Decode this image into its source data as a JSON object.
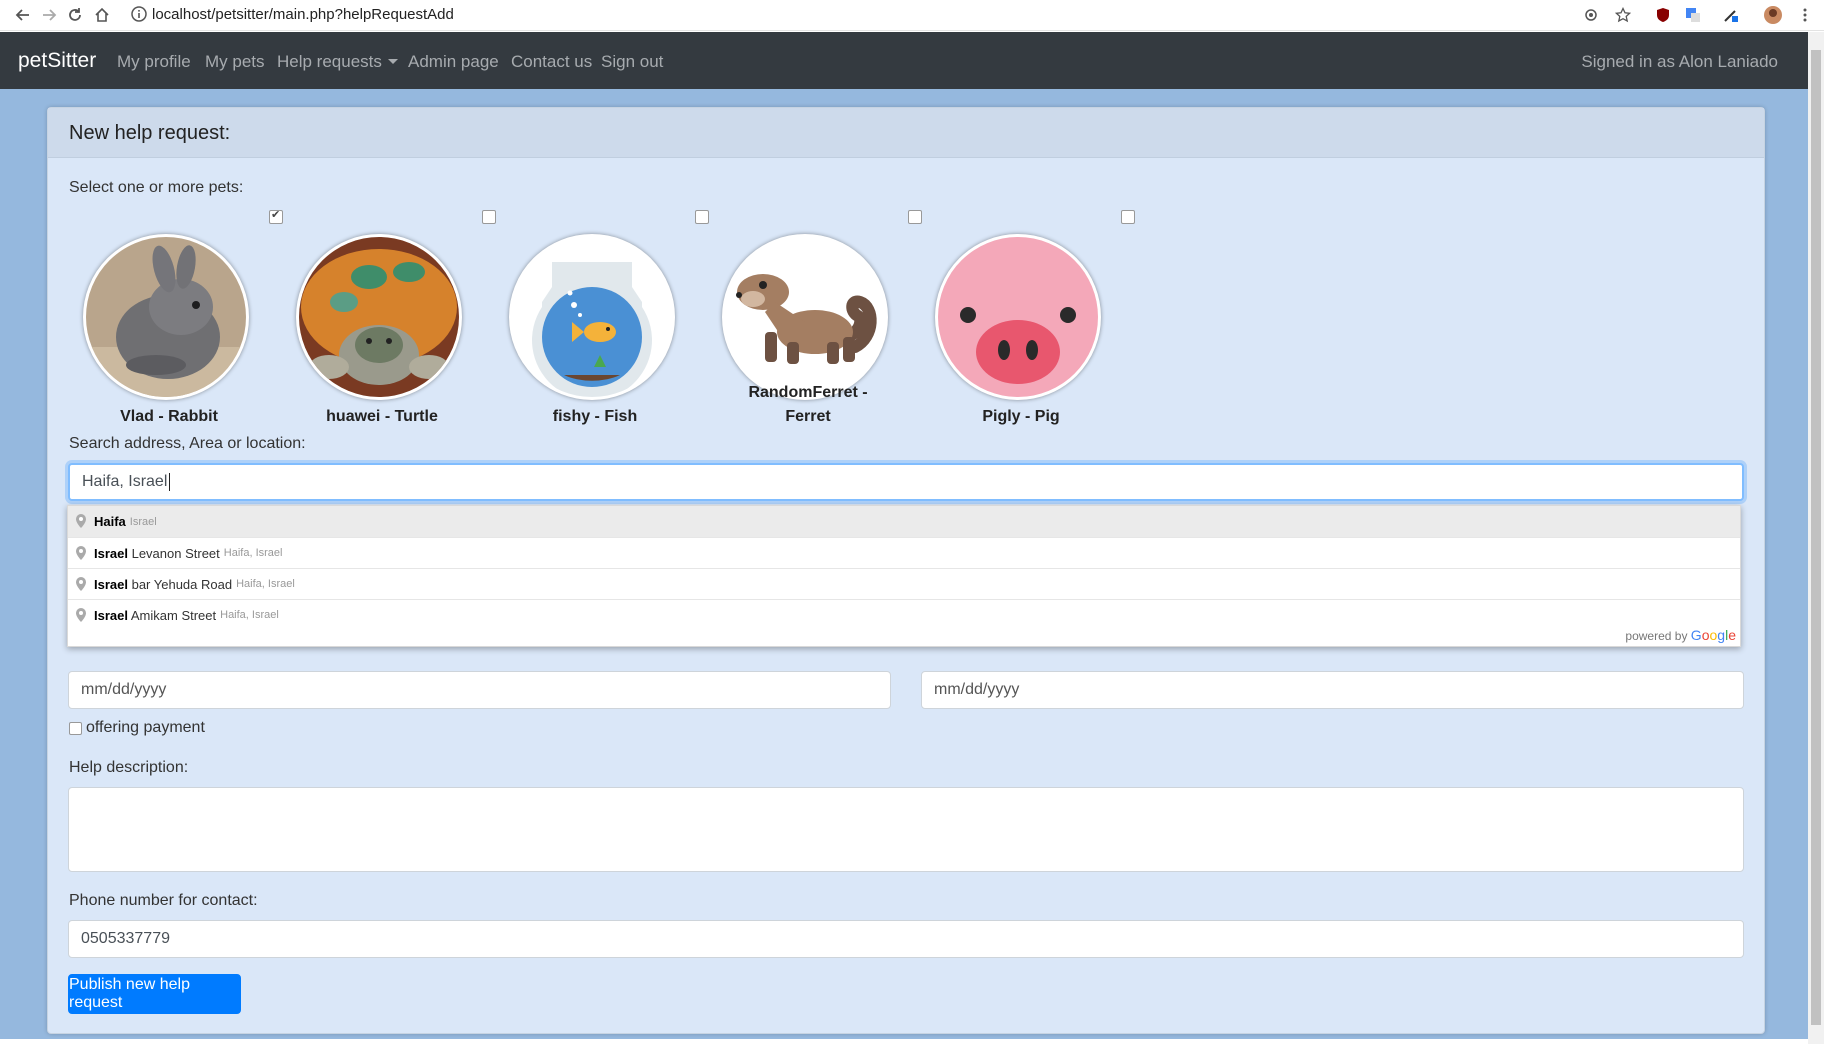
{
  "browser": {
    "url": "localhost/petsitter/main.php?helpRequestAdd"
  },
  "navbar": {
    "brand": "petSitter",
    "links": [
      "My profile",
      "My pets",
      "Help requests",
      "Admin page",
      "Contact us",
      "Sign out"
    ],
    "signed_in": "Signed in as Alon Laniado"
  },
  "form": {
    "title": "New help request:",
    "pets_label": "Select one or more pets:",
    "pets": [
      {
        "name": "Vlad - Rabbit",
        "checked": true,
        "icon": "rabbit-photo"
      },
      {
        "name": "huawei - Turtle",
        "checked": false,
        "icon": "turtle-photo"
      },
      {
        "name": "fishy - Fish",
        "checked": false,
        "icon": "fishbowl-icon"
      },
      {
        "name_line1": "RandomFerret -",
        "name_line2": "Ferret",
        "checked": false,
        "icon": "ferret-icon"
      },
      {
        "name": "Pigly - Pig",
        "checked": false,
        "icon": "pig-icon"
      }
    ],
    "address_label": "Search address, Area or location:",
    "address_value": "Haifa, Israel",
    "autocomplete": [
      {
        "main": "Haifa",
        "rest": "",
        "secondary": "Israel"
      },
      {
        "main": "Israel",
        "rest": " Levanon Street",
        "secondary": "Haifa, Israel"
      },
      {
        "main": "Israel",
        "rest": " bar Yehuda Road",
        "secondary": "Haifa, Israel"
      },
      {
        "main": "Israel",
        "rest": " Amikam Street",
        "secondary": "Haifa, Israel"
      }
    ],
    "powered_by": "powered by",
    "google": {
      "g1": "G",
      "o1": "o",
      "o2": "o",
      "g2": "g",
      "l": "l",
      "e": "e"
    },
    "start_date_placeholder": "mm/dd/yyyy",
    "end_date_placeholder": "mm/dd/yyyy",
    "payment_label": "offering payment",
    "description_label": "Help description:",
    "description_value": "",
    "phone_label": "Phone number for contact:",
    "phone_value": "0505337779",
    "submit_label": "Publish new help request"
  }
}
